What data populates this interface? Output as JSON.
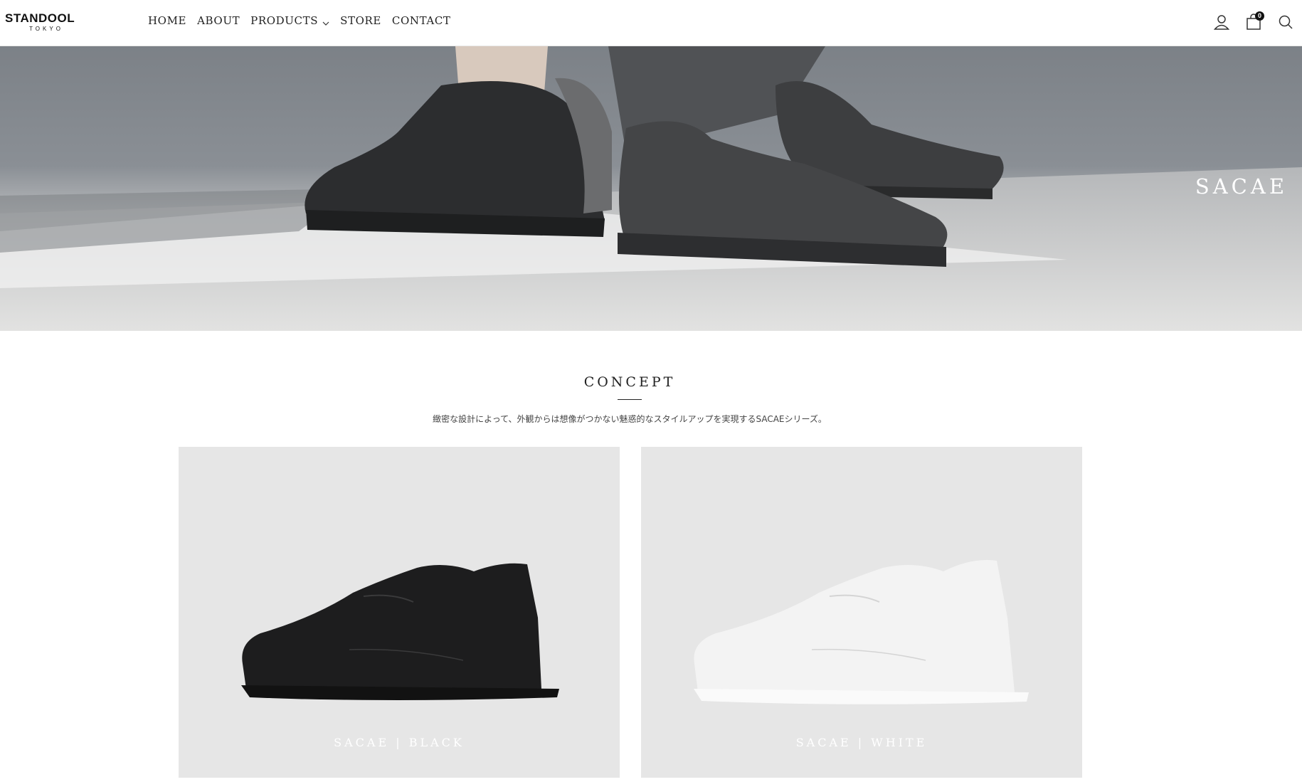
{
  "brand": {
    "name": "STANDOOL",
    "sub": "TOKYO"
  },
  "nav": {
    "items": [
      {
        "label": "HOME"
      },
      {
        "label": "ABOUT"
      },
      {
        "label": "PRODUCTS"
      },
      {
        "label": "STORE"
      },
      {
        "label": "CONTACT"
      }
    ]
  },
  "header_icons": {
    "account": "user-icon",
    "cart": "cart-icon",
    "cart_count": "0",
    "search": "search-icon"
  },
  "hero": {
    "title": "SACAE"
  },
  "concept": {
    "title": "CONCEPT",
    "text": "緻密な設計によって、外観からは想像がつかない魅惑的なスタイルアップを実現するSACAEシリーズ。"
  },
  "products": [
    {
      "label": "SACAE | BLACK"
    },
    {
      "label": "SACAE | WHITE"
    }
  ],
  "colors": {
    "card_bg": "#e6e6e6",
    "text": "#222222",
    "accent": "#111111"
  }
}
